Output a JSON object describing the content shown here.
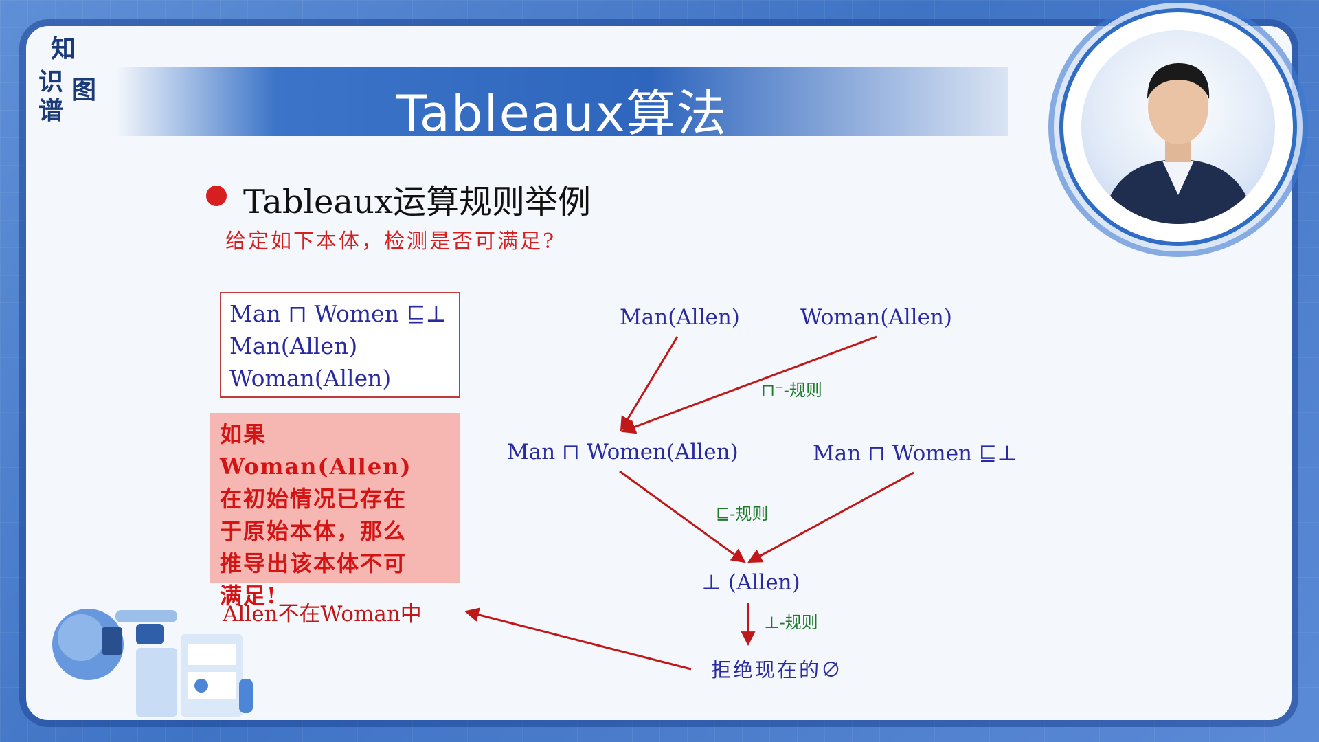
{
  "logo": {
    "chars": [
      "知",
      "识",
      "图",
      "谱"
    ]
  },
  "title": "Tableaux算法",
  "heading": "Tableaux运算规则举例",
  "question": "给定如下本体，检测是否可满足?",
  "ontology_box": {
    "lines": [
      "Man ⊓ Women ⊑⊥",
      "Man(Allen)",
      "Woman(Allen)"
    ]
  },
  "note_box": {
    "lines": [
      "如果Woman(Allen)",
      "在初始情况已存在",
      "于原始本体，那么",
      "推导出该本体不可",
      "满足!"
    ]
  },
  "diagram": {
    "node_man_allen": "Man(Allen)",
    "node_woman_allen": "Woman(Allen)",
    "rule_conj": "⊓⁻-规则",
    "node_man_women_allen": "Man ⊓ Women(Allen)",
    "node_man_women_bottom": "Man ⊓ Women ⊑⊥",
    "rule_subsume": "⊑-规则",
    "node_bottom_allen": "⊥ (Allen)",
    "rule_bottom": "⊥-规则",
    "node_reject": "拒绝现在的∅",
    "node_allen_not_woman": "Allen不在Woman中"
  },
  "colors": {
    "accent_red": "#d71f1f",
    "node_blue": "#2a2aa0",
    "rule_green": "#1f7a2a",
    "arrow_red": "#c01818",
    "note_bg": "#f6b6b2",
    "banner_blue": "#2f66bd"
  }
}
